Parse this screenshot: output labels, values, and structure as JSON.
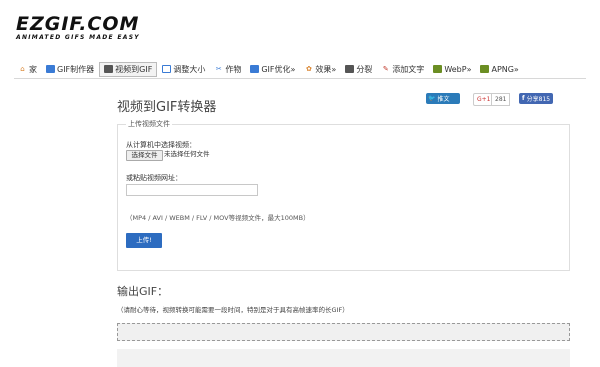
{
  "logo": {
    "main": "EZGIF.COM",
    "tagline": "ANIMATED GIFS MADE EASY"
  },
  "nav": {
    "items": [
      {
        "label": "家",
        "icon": "home-icon",
        "color": "#d9822b"
      },
      {
        "label": "GIF制作器",
        "icon": "gif-maker-icon",
        "color": "#3a7bd5"
      },
      {
        "label": "视频到GIF",
        "icon": "video-icon",
        "color": "#555555",
        "active": true
      },
      {
        "label": "调整大小",
        "icon": "resize-icon",
        "color": "#3a7bd5"
      },
      {
        "label": "作物",
        "icon": "crop-icon",
        "color": "#3a7bd5"
      },
      {
        "label": "GIF优化»",
        "icon": "optimize-icon",
        "color": "#3a7bd5"
      },
      {
        "label": "效果»",
        "icon": "effects-icon",
        "color": "#d9822b"
      },
      {
        "label": "分裂",
        "icon": "split-icon",
        "color": "#555555"
      },
      {
        "label": "添加文字",
        "icon": "text-icon",
        "color": "#c0392b"
      },
      {
        "label": "WebP»",
        "icon": "webp-icon",
        "color": "#6b8e23"
      },
      {
        "label": "APNG»",
        "icon": "apng-icon",
        "color": "#6b8e23"
      }
    ]
  },
  "page": {
    "title": "视频到GIF转换器"
  },
  "share": {
    "tweet": "推文",
    "gplus": "G+1",
    "gplus_count": "281",
    "fb": "分享815"
  },
  "upload": {
    "legend": "上传视频文件",
    "from_computer": "从计算机中选择视频：",
    "choose_file": "选择文件",
    "no_file": "未选择任何文件",
    "or_paste": "或粘贴视频网址：",
    "url_value": "",
    "formats": "（MP4 / AVI / WEBM / FLV / MOV等视频文件，最大100MB）",
    "button": "上传!"
  },
  "output": {
    "title": "输出GIF：",
    "note": "（请耐心等待，视频转换可能需要一段时间，特别是对于具有高帧速率的长GIF）"
  },
  "colors": {
    "upload_button": "#2d6cc0",
    "tweet": "#2b7bb9",
    "facebook": "#4267b2"
  }
}
